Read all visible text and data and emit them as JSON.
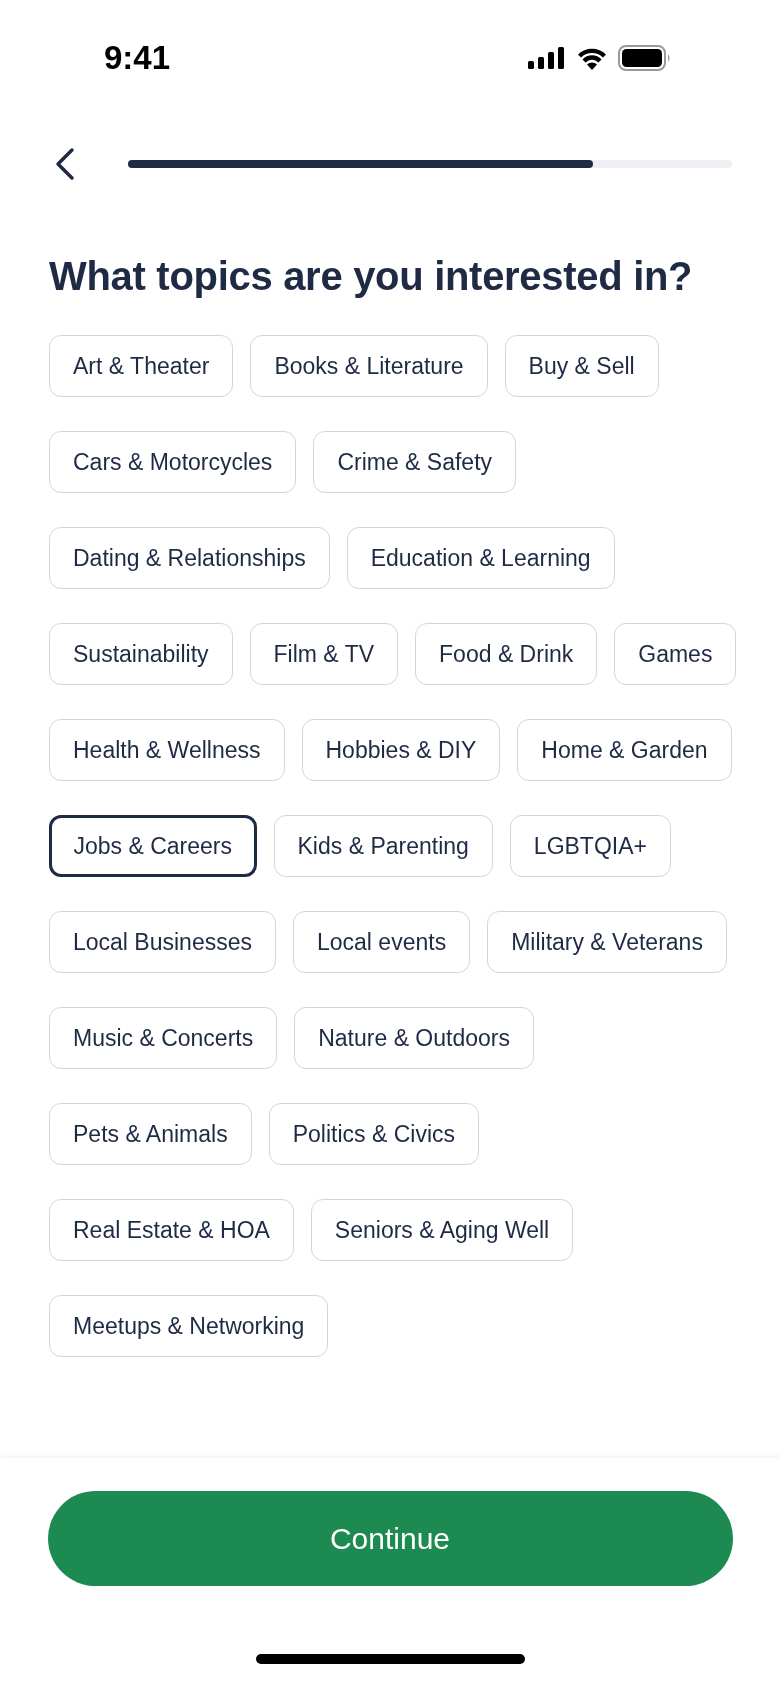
{
  "status_bar": {
    "time": "9:41"
  },
  "progress": {
    "level": 0.77
  },
  "title": "What topics are you interested in?",
  "topics": [
    {
      "label": "Art & Theater",
      "selected": false
    },
    {
      "label": "Books & Literature",
      "selected": false
    },
    {
      "label": "Buy & Sell",
      "selected": false
    },
    {
      "label": "Cars & Motorcycles",
      "selected": false
    },
    {
      "label": "Crime & Safety",
      "selected": false
    },
    {
      "label": "Dating & Relationships",
      "selected": false
    },
    {
      "label": "Education & Learning",
      "selected": false
    },
    {
      "label": "Sustainability",
      "selected": false
    },
    {
      "label": "Film & TV",
      "selected": false
    },
    {
      "label": "Food & Drink",
      "selected": false
    },
    {
      "label": "Games",
      "selected": false
    },
    {
      "label": "Health & Wellness",
      "selected": false
    },
    {
      "label": "Hobbies & DIY",
      "selected": false
    },
    {
      "label": "Home & Garden",
      "selected": false
    },
    {
      "label": "Jobs & Careers",
      "selected": true
    },
    {
      "label": "Kids & Parenting",
      "selected": false
    },
    {
      "label": "LGBTQIA+",
      "selected": false
    },
    {
      "label": "Local Businesses",
      "selected": false
    },
    {
      "label": "Local events",
      "selected": false
    },
    {
      "label": "Military & Veterans",
      "selected": false
    },
    {
      "label": "Music & Concerts",
      "selected": false
    },
    {
      "label": "Nature & Outdoors",
      "selected": false
    },
    {
      "label": "Pets & Animals",
      "selected": false
    },
    {
      "label": "Politics & Civics",
      "selected": false
    },
    {
      "label": "Real Estate & HOA",
      "selected": false
    },
    {
      "label": "Seniors & Aging Well",
      "selected": false
    },
    {
      "label": "Meetups & Networking",
      "selected": false
    }
  ],
  "continue_button": "Continue"
}
